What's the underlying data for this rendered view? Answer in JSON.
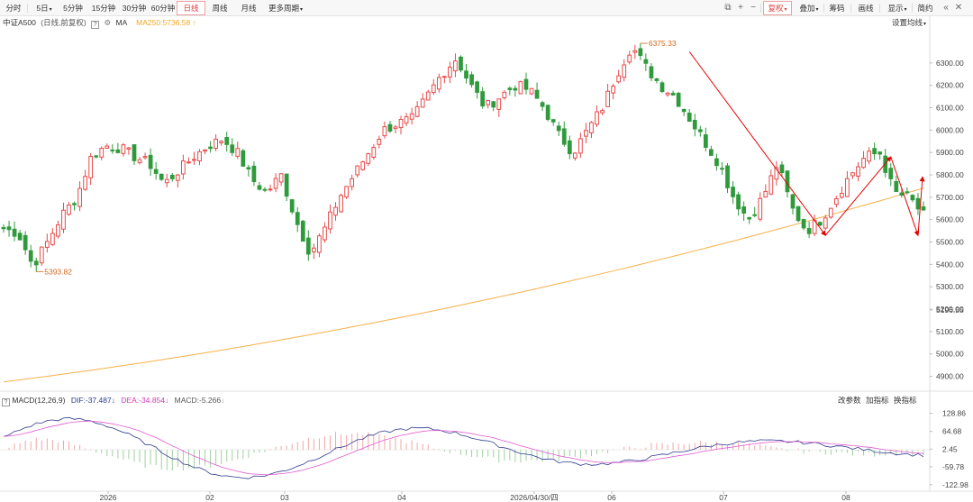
{
  "toolbar": {
    "periods": [
      "分时",
      "5日",
      "5分钟",
      "15分钟",
      "30分钟",
      "60分钟",
      "日线",
      "周线",
      "月线",
      "更多周期"
    ],
    "active_period": "日线",
    "right_tools": [
      "复权",
      "叠加",
      "筹码",
      "画线",
      "显示",
      "简约"
    ],
    "active_tool": "复权"
  },
  "indicator": {
    "name": "中证A500",
    "desc": "(日线,前复权)",
    "ma_label": "MA",
    "ma250": "MA250:5736.58",
    "settings": "设置均线"
  },
  "price_axis": {
    "ticks": [
      "6300.00",
      "6200.00",
      "6100.00",
      "6000.00",
      "5900.00",
      "5800.00",
      "5700.00",
      "5600.00",
      "5500.00",
      "5400.00",
      "5300.00",
      "5200.00",
      "5100.00",
      "5000.00",
      "4900.00"
    ],
    "current": "5196.55"
  },
  "annotations": {
    "high": "6375.33",
    "low": "5393.82"
  },
  "macd": {
    "title": "MACD(12,26,9)",
    "dif": "DIF:-37.487",
    "dea": "DEA:-34.854",
    "macd": "MACD:-5.266",
    "buttons": [
      "改参数",
      "加指标",
      "换指标"
    ],
    "ticks": [
      "128.86",
      "64.68",
      "2.45",
      "-59.78",
      "-122.98"
    ]
  },
  "x_axis": {
    "labels": [
      "2026",
      "02",
      "03",
      "04",
      "2026/04/30/四",
      "06",
      "07",
      "08"
    ]
  },
  "colors": {
    "up": "#e84a4a",
    "down": "#2f9a3c",
    "ma250": "#f5b14a",
    "dif": "#2f3b8f",
    "dea": "#e05ad0",
    "arrow": "#e60000"
  },
  "chart_data": {
    "type": "candlestick",
    "title": "中证A500",
    "ylim": [
      4850,
      6420
    ],
    "series": [
      {
        "name": "MA250",
        "start": 4875,
        "end": 5736.58
      }
    ],
    "extremes": {
      "high": 6375.33,
      "low": 5393.82
    },
    "waypoints": [
      5560,
      5540,
      5394,
      5500,
      5620,
      5700,
      5880,
      5930,
      5920,
      5880,
      5850,
      5760,
      5820,
      5880,
      5930,
      5960,
      5900,
      5780,
      5720,
      5800,
      5600,
      5450,
      5560,
      5700,
      5800,
      5900,
      6000,
      6030,
      6050,
      6150,
      6250,
      6320,
      6200,
      6100,
      6150,
      6200,
      6180,
      6100,
      5980,
      5900,
      6000,
      6100,
      6250,
      6375,
      6280,
      6200,
      6150,
      6050,
      5950,
      5850,
      5700,
      5600,
      5700,
      5850,
      5650,
      5550,
      5600,
      5700,
      5800,
      5880,
      5900,
      5720,
      5700,
      5620
    ]
  }
}
